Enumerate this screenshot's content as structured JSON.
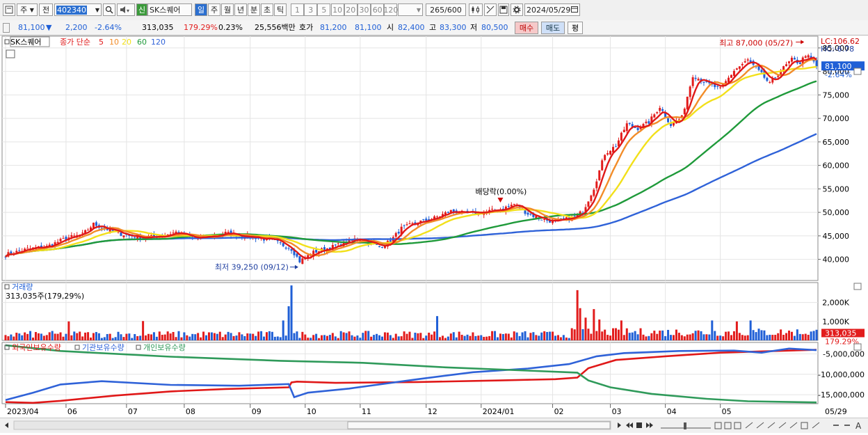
{
  "toolbar": {
    "type_label": "주",
    "market_label": "전",
    "code_value": "402340",
    "credit_badge": "신",
    "name_value": "SK스퀘어",
    "periods": [
      "일",
      "주",
      "월",
      "년",
      "분",
      "초",
      "틱"
    ],
    "active_period": "일",
    "intervals": [
      "1",
      "3",
      "5",
      "10",
      "20",
      "30",
      "60",
      "120"
    ],
    "count_value": "265",
    "count_total": "/600",
    "date_value": "2024/05/29",
    "icons": [
      "chart-type-icon",
      "arrow-icon",
      "search-icon",
      "sound-icon",
      "crosshair-icon",
      "tool-icon",
      "save-icon",
      "settings-icon",
      "calendar-icon"
    ]
  },
  "quote": {
    "price": "81,100",
    "change_arrow": "▼",
    "change": "2,200",
    "change_pct": "-2.64%",
    "volume": "313,035",
    "volume_ratio": "179.29%",
    "turnover": "0.23%",
    "amount": "25,556백만",
    "ask_label": "호가",
    "ask": "81,200",
    "bid": "81,100",
    "open_label": "시",
    "open": "82,400",
    "high_label": "고",
    "high": "83,300",
    "low_label": "저",
    "low": "80,500",
    "buy_label": "매수",
    "sell_label": "매도",
    "pin_label": "평"
  },
  "colors": {
    "up": "#e21c1c",
    "down": "#1f5fd6",
    "ma5": "#e01818",
    "ma10": "#f28c28",
    "ma20": "#f2e01a",
    "ma60": "#1f9a3a",
    "ma120": "#2f62d8",
    "foreign": "#e01818",
    "institution": "#2f62d8",
    "individual": "#2f9a5a"
  },
  "chart_data": [
    {
      "type": "candlestick",
      "title": "SK스퀘어",
      "legend": [
        "종가 단순",
        "5",
        "10",
        "20",
        "60",
        "120"
      ],
      "x_labels": [
        "2023/04",
        "06",
        "07",
        "08",
        "09",
        "10",
        "11",
        "12",
        "2024/01",
        "02",
        "03",
        "04",
        "05"
      ],
      "y_ticks": [
        "85,000",
        "80,000",
        "75,000",
        "70,000",
        "65,000",
        "60,000",
        "55,000",
        "50,000",
        "45,000",
        "40,000"
      ],
      "ylim": [
        35500,
        87500
      ],
      "lc_label": "LC:106.62",
      "hc_label": "HC:-6.78",
      "last_price": "81,100",
      "last_change_pct": "-2.64%",
      "annotations": {
        "high": "최고 87,000 (05/27)",
        "low": "최저 39,250 (09/12)",
        "dividend": "배당락(0.00%)"
      },
      "anchors": [
        [
          0,
          41000
        ],
        [
          8,
          42200
        ],
        [
          15,
          42700
        ],
        [
          22,
          44500
        ],
        [
          28,
          45300
        ],
        [
          32,
          47500
        ],
        [
          37,
          46400
        ],
        [
          42,
          45400
        ],
        [
          50,
          44600
        ],
        [
          56,
          44900
        ],
        [
          62,
          45800
        ],
        [
          68,
          44400
        ],
        [
          74,
          44800
        ],
        [
          80,
          45600
        ],
        [
          86,
          45000
        ],
        [
          92,
          44600
        ],
        [
          98,
          43800
        ],
        [
          104,
          42200
        ],
        [
          107,
          39600
        ],
        [
          112,
          41500
        ],
        [
          118,
          42500
        ],
        [
          124,
          43600
        ],
        [
          128,
          44500
        ],
        [
          132,
          43700
        ],
        [
          136,
          42600
        ],
        [
          140,
          43900
        ],
        [
          144,
          46600
        ],
        [
          150,
          47900
        ],
        [
          156,
          48800
        ],
        [
          162,
          50300
        ],
        [
          168,
          49700
        ],
        [
          174,
          50100
        ],
        [
          180,
          50600
        ],
        [
          185,
          51800
        ],
        [
          190,
          49700
        ],
        [
          196,
          48400
        ],
        [
          200,
          48000
        ],
        [
          206,
          48800
        ],
        [
          210,
          50200
        ],
        [
          214,
          55200
        ],
        [
          218,
          62500
        ],
        [
          222,
          64200
        ],
        [
          226,
          68800
        ],
        [
          230,
          67900
        ],
        [
          234,
          69200
        ],
        [
          238,
          72500
        ],
        [
          242,
          68600
        ],
        [
          246,
          70200
        ],
        [
          250,
          79200
        ],
        [
          255,
          77500
        ],
        [
          260,
          76200
        ],
        [
          265,
          80200
        ],
        [
          270,
          82400
        ],
        [
          275,
          79400
        ],
        [
          278,
          77300
        ],
        [
          282,
          80200
        ],
        [
          286,
          82500
        ],
        [
          289,
          81800
        ],
        [
          291,
          83600
        ],
        [
          294,
          82000
        ],
        [
          295,
          81100
        ]
      ],
      "n_bars": 296
    },
    {
      "type": "bar",
      "title": "거래량",
      "subtitle": "313,035주(179,29%)",
      "y_ticks": [
        "2,000K",
        "1,000K"
      ],
      "ylim": [
        0,
        3050
      ],
      "last_value": "313,035",
      "last_pct": "179.29%",
      "spikes": [
        [
          23,
          1000
        ],
        [
          50,
          1020
        ],
        [
          101,
          1050
        ],
        [
          103,
          1800
        ],
        [
          104,
          2900
        ],
        [
          157,
          1280
        ],
        [
          208,
          2650
        ],
        [
          209,
          1700
        ],
        [
          211,
          1200
        ],
        [
          214,
          1650
        ],
        [
          216,
          1100
        ],
        [
          224,
          1050
        ],
        [
          257,
          1050
        ],
        [
          266,
          1000
        ],
        [
          271,
          1050
        ]
      ]
    },
    {
      "type": "line",
      "series_legend": [
        "외국인보유수량",
        "기관보유수량",
        "개인보유수량"
      ],
      "y_ticks": [
        "-5,000,000",
        "-10,000,000",
        "-15,000,000"
      ],
      "ylim": [
        -17200000,
        -2200000
      ],
      "series": [
        {
          "name": "외국인보유수량",
          "key": "foreign",
          "points": [
            [
              0,
              -16800000
            ],
            [
              10,
              -17000000
            ],
            [
              20,
              -16500000
            ],
            [
              40,
              -15200000
            ],
            [
              60,
              -14200000
            ],
            [
              80,
              -13600000
            ],
            [
              103,
              -13200000
            ],
            [
              104,
              -12000000
            ],
            [
              106,
              -11800000
            ],
            [
              120,
              -12100000
            ],
            [
              150,
              -11900000
            ],
            [
              180,
              -11500000
            ],
            [
              200,
              -11200000
            ],
            [
              208,
              -10800000
            ],
            [
              212,
              -8500000
            ],
            [
              222,
              -6500000
            ],
            [
              240,
              -5600000
            ],
            [
              260,
              -4700000
            ],
            [
              280,
              -4300000
            ],
            [
              295,
              -4000000
            ]
          ]
        },
        {
          "name": "기관보유수량",
          "key": "institution",
          "points": [
            [
              0,
              -16300000
            ],
            [
              10,
              -14500000
            ],
            [
              20,
              -12500000
            ],
            [
              35,
              -11700000
            ],
            [
              60,
              -12600000
            ],
            [
              85,
              -12800000
            ],
            [
              103,
              -12400000
            ],
            [
              105,
              -15600000
            ],
            [
              110,
              -14500000
            ],
            [
              125,
              -13500000
            ],
            [
              150,
              -11200000
            ],
            [
              170,
              -9500000
            ],
            [
              190,
              -8600000
            ],
            [
              205,
              -7500000
            ],
            [
              215,
              -5600000
            ],
            [
              225,
              -4800000
            ],
            [
              245,
              -4300000
            ],
            [
              265,
              -4200000
            ],
            [
              275,
              -4700000
            ],
            [
              285,
              -3700000
            ],
            [
              295,
              -4100000
            ]
          ]
        },
        {
          "name": "개인보유수량",
          "key": "individual",
          "points": [
            [
              0,
              -2900000
            ],
            [
              20,
              -4300000
            ],
            [
              60,
              -5700000
            ],
            [
              100,
              -6700000
            ],
            [
              130,
              -7200000
            ],
            [
              160,
              -8300000
            ],
            [
              190,
              -9100000
            ],
            [
              208,
              -9600000
            ],
            [
              212,
              -11500000
            ],
            [
              220,
              -13200000
            ],
            [
              235,
              -14800000
            ],
            [
              255,
              -16000000
            ],
            [
              270,
              -16600000
            ],
            [
              295,
              -16900000
            ]
          ]
        }
      ]
    }
  ],
  "bottom": {
    "date_label": "05/29"
  }
}
